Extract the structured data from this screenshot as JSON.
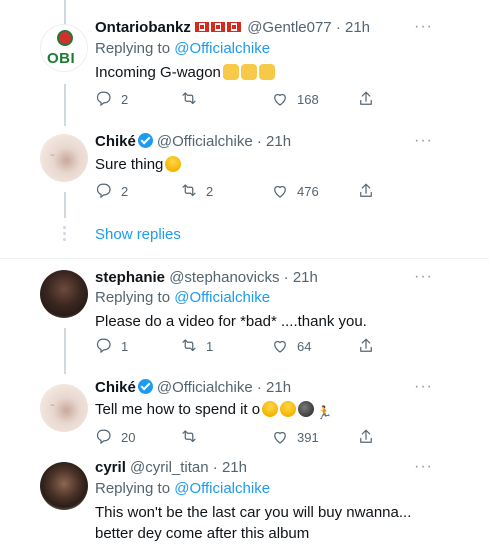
{
  "tweets": [
    {
      "name": "Ontariobankz",
      "handle": "@Gentle077",
      "time": "· 21h",
      "replying_prefix": "Replying to ",
      "replying_to": "@Officialchike",
      "text": "Incoming G-wagon",
      "avatar_text": "OBI",
      "replies": "2",
      "retweets": "",
      "likes": "168"
    },
    {
      "name": "Chiké",
      "handle": "@Officialchike",
      "time": "· 21h",
      "text": "Sure thing",
      "replies": "2",
      "retweets": "2",
      "likes": "476"
    },
    {
      "name": "stephanie",
      "handle": "@stephanovicks",
      "time": "· 21h",
      "replying_prefix": "Replying to ",
      "replying_to": "@Officialchike",
      "text": "Please do a video for *bad* ....thank you.",
      "replies": "1",
      "retweets": "1",
      "likes": "64"
    },
    {
      "name": "Chiké",
      "handle": "@Officialchike",
      "time": "· 21h",
      "text": "Tell me how to spend it o",
      "replies": "20",
      "retweets": "",
      "likes": "391"
    },
    {
      "name": "cyril",
      "handle": "@cyril_titan",
      "time": "· 21h",
      "replying_prefix": "Replying to ",
      "replying_to": "@Officialchike",
      "text_line1": "This won't be the last car you will buy nwanna...",
      "text_line2": "better dey come after this album"
    }
  ],
  "show_replies": "Show replies",
  "more_glyph": "···",
  "icons": {
    "reply": "reply-icon",
    "retweet": "retweet-icon",
    "like": "heart-icon",
    "share": "share-icon",
    "verified": "verified-badge-icon"
  },
  "colors": {
    "accent": "#1d9bf0",
    "text": "#0f1419",
    "muted": "#536471"
  }
}
